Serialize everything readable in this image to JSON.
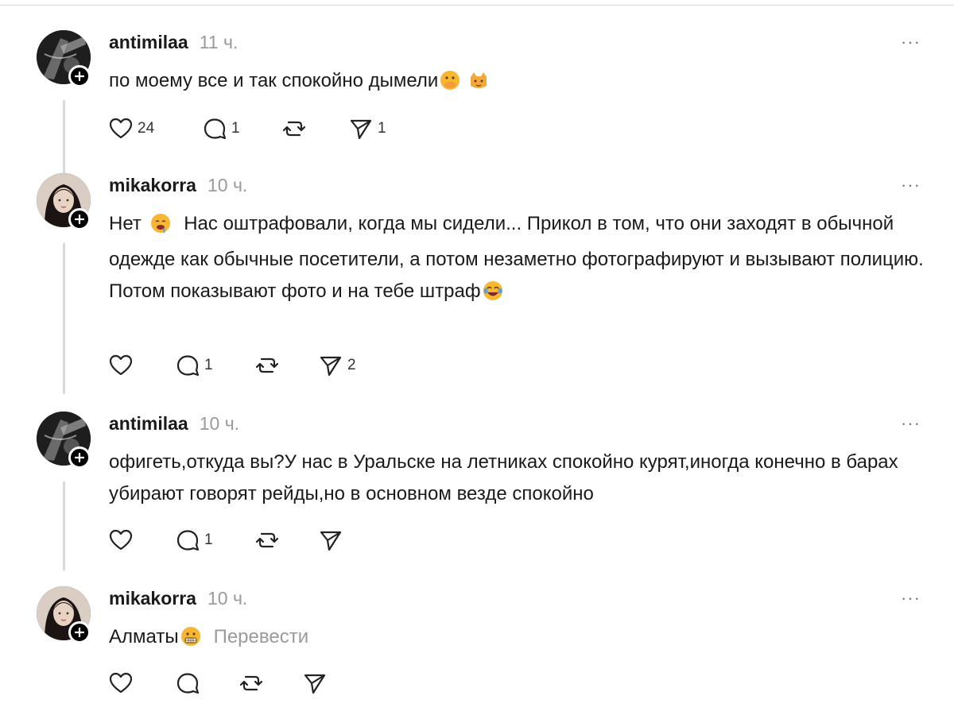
{
  "comments": [
    {
      "username": "antimilaa",
      "time": "11 ч.",
      "more_label": "···",
      "text": "по моему все и так спокойно дымели",
      "emojis": [
        "face-with-hand-over-mouth-emoji",
        "cat-emoji"
      ],
      "likes": "24",
      "replies": "1",
      "reposts": "",
      "shares": "1",
      "avatar_icon": "dark-avatar"
    },
    {
      "username": "mikakorra",
      "time": "10 ч.",
      "more_label": "···",
      "text_before": "Нет",
      "text_after": "Нас оштрафовали, когда мы сидели... Прикол в том, что они заходят в обычной одежде как обычные посетители, а потом незаметно фотографируют и вызывают полицию. Потом показывают фото и на тебе штраф",
      "emojis": [
        "drooling-face-emoji",
        "laughing-tears-emoji"
      ],
      "likes": "",
      "replies": "1",
      "reposts": "",
      "shares": "2",
      "avatar_icon": "girl-avatar"
    },
    {
      "username": "antimilaa",
      "time": "10 ч.",
      "more_label": "···",
      "text": "офигеть,откуда вы?У нас в Уральске на летниках спокойно курят,иногда конечно в барах убирают говорят рейды,но в основном везде спокойно",
      "likes": "",
      "replies": "1",
      "reposts": "",
      "shares": "",
      "avatar_icon": "dark-avatar"
    },
    {
      "username": "mikakorra",
      "time": "10 ч.",
      "more_label": "···",
      "text": "Алматы",
      "emojis": [
        "grimacing-face-emoji"
      ],
      "translate_label": "Перевести",
      "likes": "",
      "replies": "",
      "reposts": "",
      "shares": "",
      "avatar_icon": "girl-avatar"
    }
  ],
  "icons": {
    "like": "heart-icon",
    "reply": "comment-bubble-icon",
    "repost": "repost-icon",
    "share": "paper-plane-icon",
    "follow": "plus-icon"
  },
  "colors": {
    "text": "#1a1a1a",
    "muted": "#9a9a9a",
    "thread_line": "#d8d8d8",
    "badge": "#000000"
  }
}
